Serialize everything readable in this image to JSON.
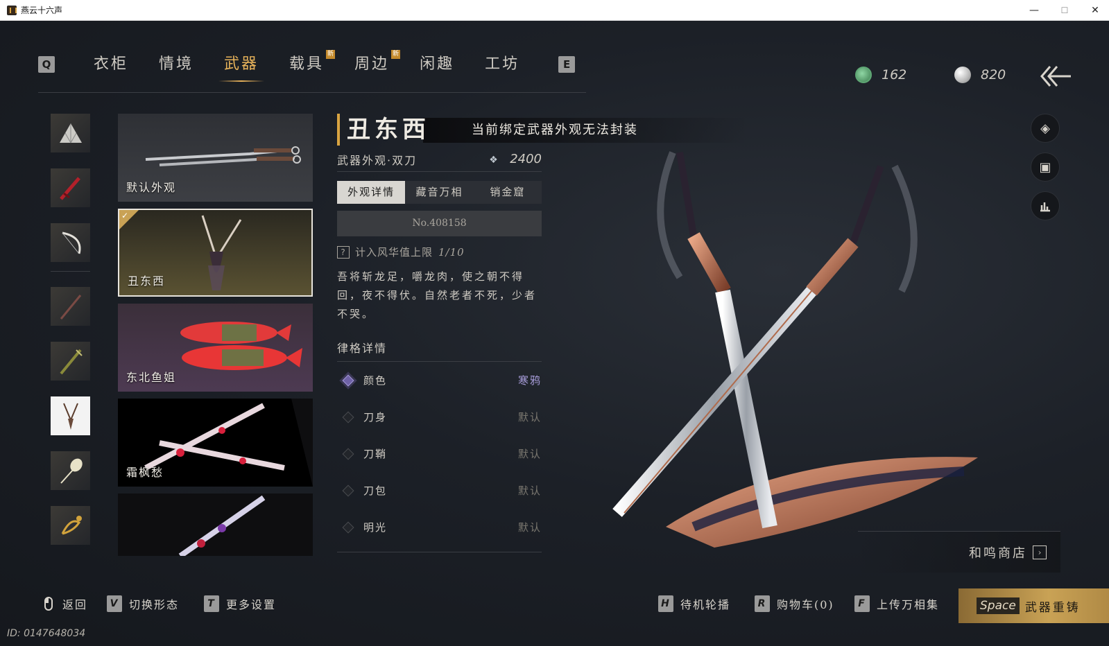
{
  "window": {
    "title": "燕云十六声"
  },
  "nav": {
    "left_key": "Q",
    "right_key": "E",
    "tabs": [
      {
        "label": "衣柜",
        "badge": ""
      },
      {
        "label": "情境",
        "badge": ""
      },
      {
        "label": "武器",
        "badge": "",
        "active": true
      },
      {
        "label": "载具",
        "badge": "新"
      },
      {
        "label": "周边",
        "badge": "新"
      },
      {
        "label": "闲趣",
        "badge": ""
      },
      {
        "label": "工坊",
        "badge": ""
      }
    ]
  },
  "currency": {
    "jade": "162",
    "pearl": "820"
  },
  "skins": [
    {
      "label": "默认外观"
    },
    {
      "label": "丑东西",
      "selected": true
    },
    {
      "label": "东北鱼姐"
    },
    {
      "label": "霜枫愁"
    },
    {
      "label": ""
    }
  ],
  "notice": "当前绑定武器外观无法封装",
  "detail": {
    "name": "丑东西",
    "type": "武器外观·双刀",
    "price": "2400",
    "tabs": [
      "外观详情",
      "藏音万相",
      "销金窟"
    ],
    "serial": "No.408158",
    "cap_label": "计入风华值上限",
    "cap_value": "1/10",
    "description": "吾将斩龙足，嚼龙肉，使之朝不得回，夜不得伏。自然老者不死，少者不哭。",
    "section_title": "律格详情",
    "attributes": [
      {
        "name": "颜色",
        "value": "寒鸦"
      },
      {
        "name": "刀身",
        "value": "默认"
      },
      {
        "name": "刀鞘",
        "value": "默认"
      },
      {
        "name": "刀包",
        "value": "默认"
      },
      {
        "name": "明光",
        "value": "默认"
      }
    ]
  },
  "shop": {
    "label": "和鸣商店"
  },
  "bottom": {
    "back": "返回",
    "switch_key": "V",
    "switch": "切换形态",
    "more_key": "T",
    "more": "更多设置",
    "idle_key": "H",
    "idle": "待机轮播",
    "cart_key": "R",
    "cart": "购物车(0)",
    "upload_key": "F",
    "upload": "上传万相集",
    "space_key": "Space",
    "space": "武器重铸"
  },
  "uid": "ID: 0147648034",
  "colors": {
    "accent": "#e7b25a",
    "gold": "#c9a255",
    "purple": "#a69bd8"
  }
}
